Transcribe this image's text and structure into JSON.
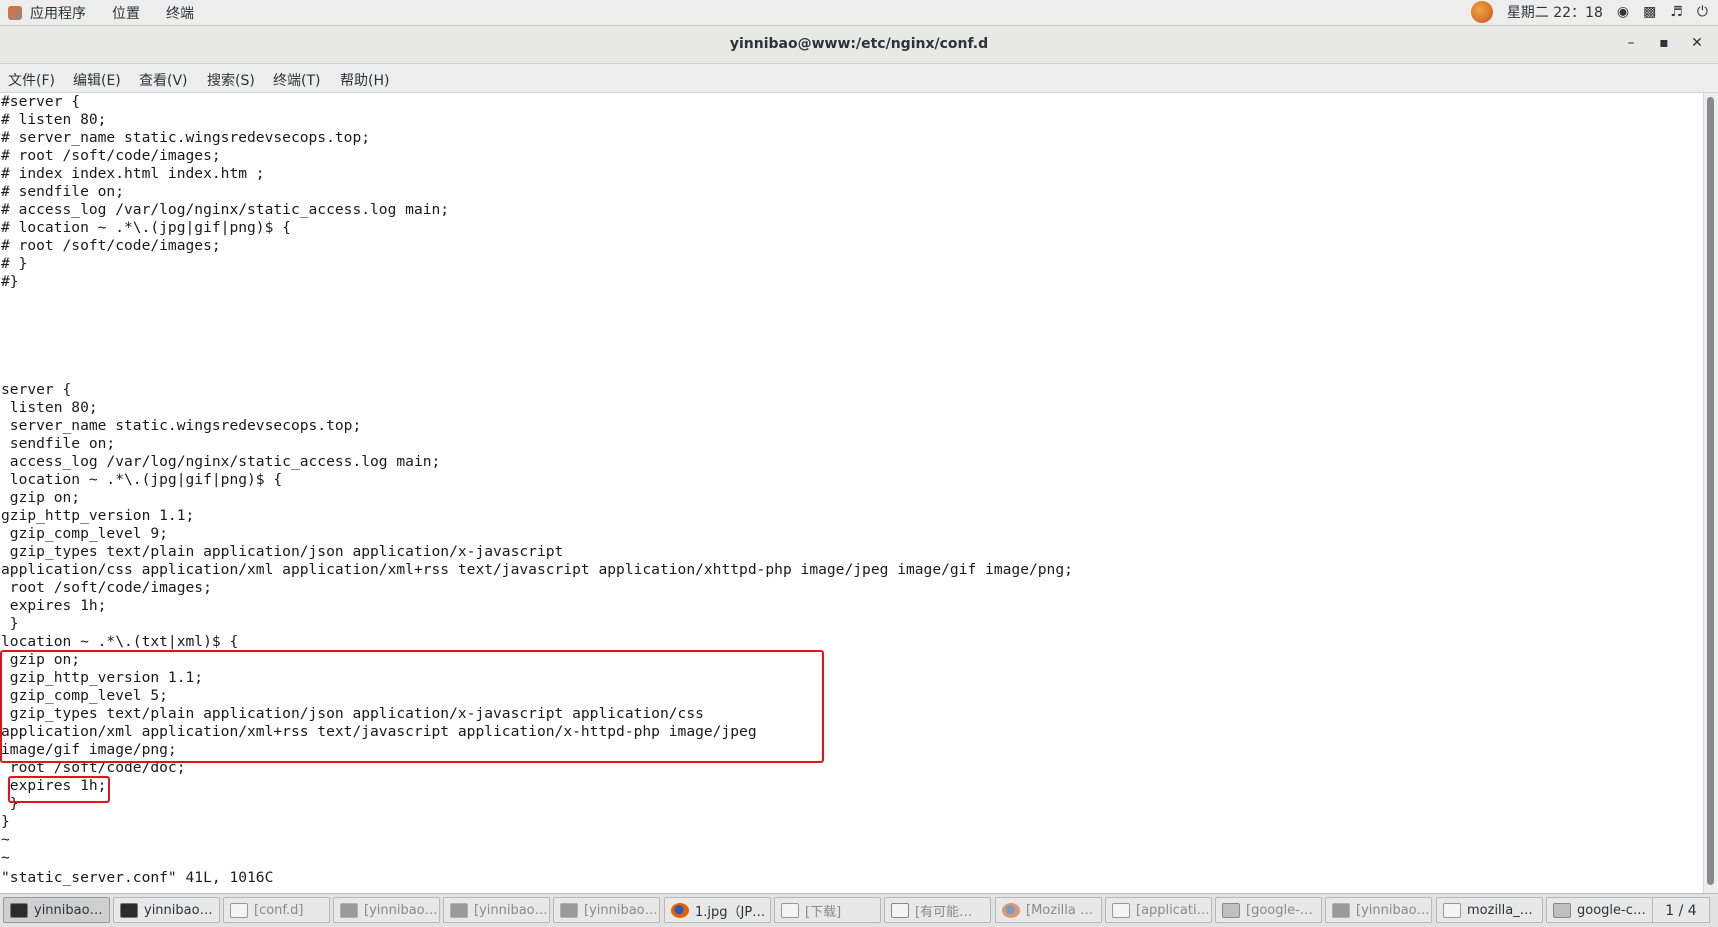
{
  "topbar": {
    "applications": "应用程序",
    "places": "位置",
    "terminal": "终端",
    "clock": "星期二 22：18"
  },
  "window": {
    "title": "yinnibao@www:/etc/nginx/conf.d",
    "minimize": "–",
    "maximize": "▪",
    "close": "✕"
  },
  "menubar": {
    "file": "文件(F)",
    "edit": "编辑(E)",
    "view": "查看(V)",
    "search": "搜索(S)",
    "terminal": "终端(T)",
    "help": "帮助(H)"
  },
  "terminal": {
    "lines": [
      "#server {",
      "# listen 80;",
      "# server_name static.wingsredevsecops.top;",
      "# root /soft/code/images;",
      "# index index.html index.htm ;",
      "# sendfile on;",
      "# access_log /var/log/nginx/static_access.log main;",
      "# location ~ .*\\.(jpg|gif|png)$ {",
      "# root /soft/code/images;",
      "# }",
      "#}",
      "",
      "",
      "",
      "",
      "",
      "server {",
      " listen 80;",
      " server_name static.wingsredevsecops.top;",
      " sendfile on;",
      " access_log /var/log/nginx/static_access.log main;",
      " location ~ .*\\.(jpg|gif|png)$ {",
      " gzip on;",
      "gzip_http_version 1.1;",
      " gzip_comp_level 9;",
      " gzip_types text/plain application/json application/x-javascript",
      "application/css application/xml application/xml+rss text/javascript application/xhttpd-php image/jpeg image/gif image/png;",
      " root /soft/code/images;",
      " expires 1h;",
      " }",
      "location ~ .*\\.(txt|xml)$ {",
      " gzip on;",
      " gzip_http_version 1.1;",
      " gzip_comp_level 5;",
      " gzip_types text/plain application/json application/x-javascript application/css",
      "application/xml application/xml+rss text/javascript application/x-httpd-php image/jpeg",
      "image/gif image/png;",
      " root /soft/code/doc;",
      " expires 1h;",
      " }",
      "}",
      "~",
      "~"
    ],
    "status": "\"static_server.conf\" 41L, 1016C"
  },
  "taskbar": {
    "items": [
      {
        "label": "yinnibao…",
        "icon": "terminal-icon"
      },
      {
        "label": "yinnibao…",
        "icon": "terminal-icon"
      },
      {
        "label": "[conf.d]",
        "icon": "folder-icon"
      },
      {
        "label": "[yinnibao…",
        "icon": "terminal-icon"
      },
      {
        "label": "[yinnibao…",
        "icon": "terminal-icon"
      },
      {
        "label": "[yinnibao…",
        "icon": "terminal-icon"
      },
      {
        "label": "1.jpg（JP…",
        "icon": "firefox-icon"
      },
      {
        "label": "[下载]",
        "icon": "folder-icon"
      },
      {
        "label": "[有可能…",
        "icon": "text-editor-icon"
      },
      {
        "label": "[Mozilla …",
        "icon": "firefox-icon"
      },
      {
        "label": "[applicati…",
        "icon": "document-icon"
      },
      {
        "label": "[google-…",
        "icon": "printer-icon"
      },
      {
        "label": "[yinnibao…",
        "icon": "terminal-icon"
      },
      {
        "label": "mozilla_…",
        "icon": "document-icon"
      },
      {
        "label": "google-c…",
        "icon": "printer-icon"
      }
    ],
    "pager": "1 / 4"
  }
}
